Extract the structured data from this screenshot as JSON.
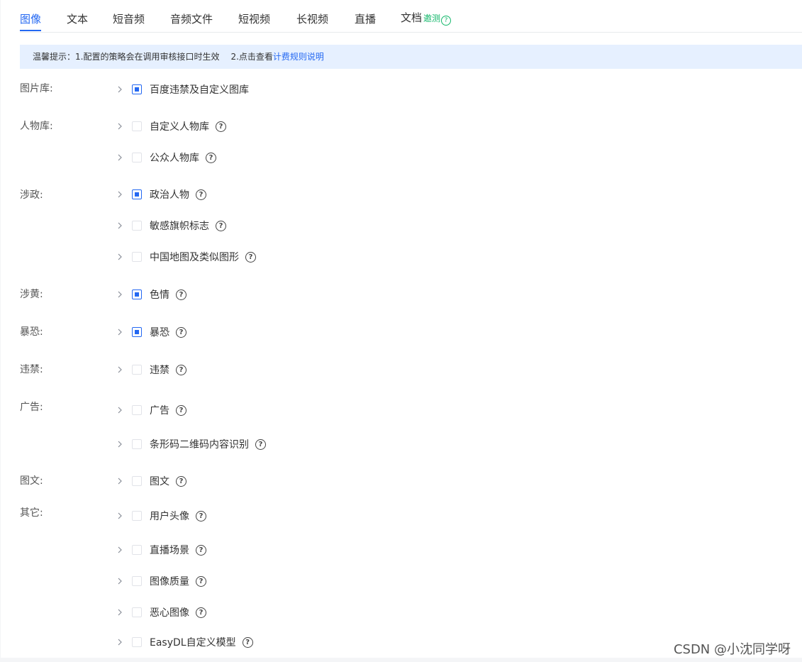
{
  "tabs": [
    {
      "label": "图像",
      "active": true
    },
    {
      "label": "文本",
      "active": false
    },
    {
      "label": "短音频",
      "active": false
    },
    {
      "label": "音频文件",
      "active": false
    },
    {
      "label": "短视频",
      "active": false
    },
    {
      "label": "长视频",
      "active": false
    },
    {
      "label": "直播",
      "active": false
    },
    {
      "label": "文档",
      "active": false,
      "badge": "邀测",
      "badge_icon": "help-icon"
    }
  ],
  "notice": {
    "prefix": "温馨提示：1.配置的策略会在调用审核接口时生效",
    "part2": "2.点击查看",
    "link": "计费规则说明"
  },
  "groups": {
    "gallery": "图片库:",
    "person": "人物库:",
    "politics": "涉政:",
    "porn": "涉黄:",
    "terror": "暴恐:",
    "prohibited": "违禁:",
    "ads": "广告:",
    "image_text": "图文:",
    "other": "其它:"
  },
  "items": [
    {
      "label": "百度违禁及自定义图库",
      "checked": true,
      "help": false
    },
    {
      "label": "自定义人物库",
      "checked": false,
      "help": true
    },
    {
      "label": "公众人物库",
      "checked": false,
      "help": true
    },
    {
      "label": "政治人物",
      "checked": true,
      "help": true
    },
    {
      "label": "敏感旗帜标志",
      "checked": false,
      "help": true
    },
    {
      "label": "中国地图及类似图形",
      "checked": false,
      "help": true
    },
    {
      "label": "色情",
      "checked": true,
      "help": true
    },
    {
      "label": "暴恐",
      "checked": true,
      "help": true
    },
    {
      "label": "违禁",
      "checked": false,
      "help": true
    },
    {
      "label": "广告",
      "checked": false,
      "help": true
    },
    {
      "label": "条形码二维码内容识别",
      "checked": false,
      "help": true
    },
    {
      "label": "图文",
      "checked": false,
      "help": true
    },
    {
      "label": "用户头像",
      "checked": false,
      "help": true
    },
    {
      "label": "直播场景",
      "checked": false,
      "help": true
    },
    {
      "label": "图像质量",
      "checked": false,
      "help": true
    },
    {
      "label": "恶心图像",
      "checked": false,
      "help": true
    },
    {
      "label": "EasyDL自定义模型",
      "checked": false,
      "help": true
    }
  ],
  "help_glyph": "?",
  "watermark": "CSDN @小沈同学呀",
  "colors": {
    "accent": "#2468f2",
    "notice_bg": "#e6f0ff",
    "beta": "#12b76a"
  }
}
